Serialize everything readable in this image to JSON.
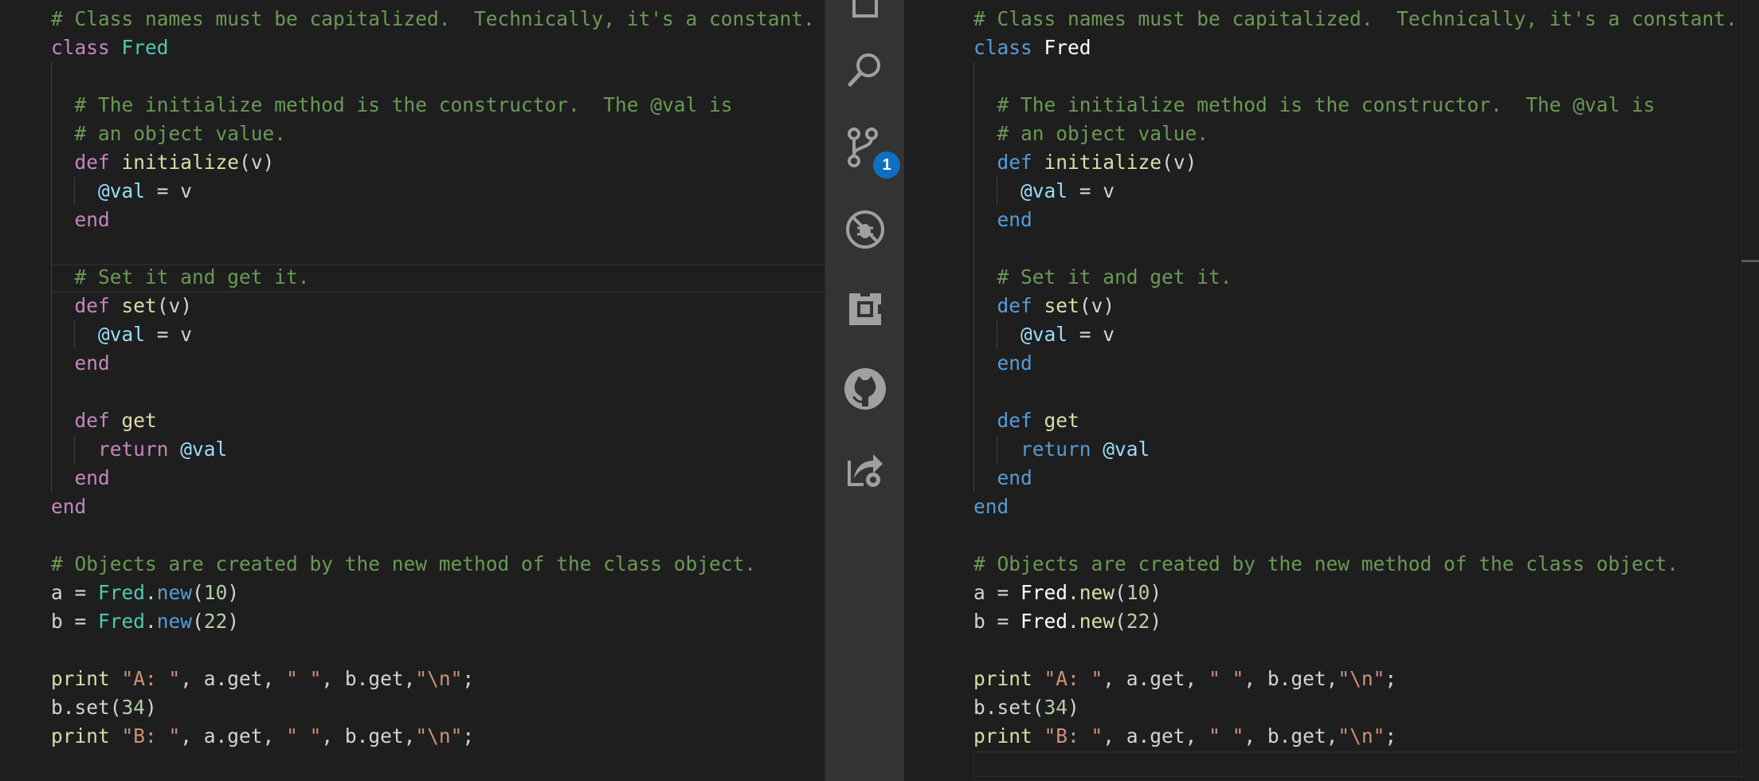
{
  "editor": {
    "code_lines": [
      "# Class names must be capitalized.  Technically, it's a constant.",
      "class Fred",
      "",
      "  # The initialize method is the constructor.  The @val is",
      "  # an object value.",
      "  def initialize(v)",
      "    @val = v",
      "  end",
      "",
      "  # Set it and get it.",
      "  def set(v)",
      "    @val = v",
      "  end",
      "",
      "  def get",
      "    return @val",
      "  end",
      "end",
      "",
      "# Objects are created by the new method of the class object.",
      "a = Fred.new(10)",
      "b = Fred.new(22)",
      "",
      "print \"A: \", a.get, \" \", b.get,\"\\n\";",
      "b.set(34)",
      "print \"B: \", a.get, \" \", b.get,\"\\n\";"
    ]
  },
  "activity_bar": {
    "icons": [
      "explorer-icon",
      "search-icon",
      "source-control-icon",
      "debug-icon",
      "extensions-icon",
      "github-icon",
      "live-share-icon"
    ],
    "source_control_badge": "1",
    "badge_color": "#0e70c0"
  },
  "theme": {
    "background": "#1e1e1e",
    "activity_bar_bg": "#333333",
    "comment": "#6a9955",
    "keyword_left": "#c586c0",
    "keyword_right": "#569cd6",
    "class_name_left": "#4ec9b0",
    "function": "#dcdcaa",
    "instance_var": "#9cdcfe",
    "string": "#ce9178",
    "number": "#b5cea8"
  }
}
